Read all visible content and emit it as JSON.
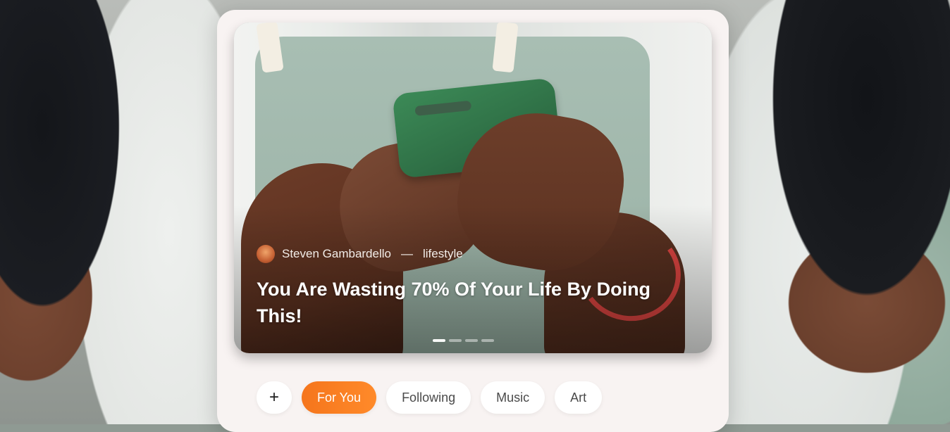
{
  "story": {
    "author": "Steven Gambardello",
    "separator": "—",
    "category": "lifestyle",
    "title": "You Are Wasting 70% Of Your Life By Doing This!",
    "slide_count": 4,
    "active_slide": 1
  },
  "tabs": {
    "add_icon": "plus-icon",
    "add_label": "+",
    "items": [
      {
        "label": "For You",
        "active": true
      },
      {
        "label": "Following",
        "active": false
      },
      {
        "label": "Music",
        "active": false
      },
      {
        "label": "Art",
        "active": false
      }
    ]
  },
  "colors": {
    "accent": "#f5751c",
    "panel": "#f8f3f2"
  }
}
